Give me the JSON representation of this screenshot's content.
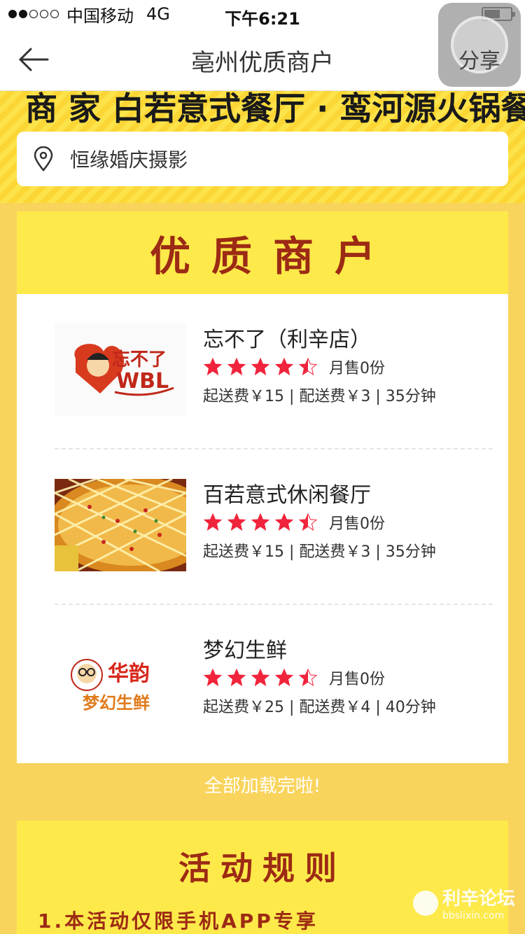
{
  "status_bar": {
    "signal_dots": 5,
    "signal_filled": 2,
    "carrier": "中国移动",
    "network": "4G",
    "time": "下午6:21",
    "battery_level": 0.5
  },
  "nav": {
    "back_icon": "arrow-left-icon",
    "title": "亳州优质商户",
    "share_label": "分享"
  },
  "banner": {
    "text_partial": "商  家  白若意式餐厅 · 鸾河源火锅餐厅"
  },
  "location": {
    "icon": "map-pin-icon",
    "text": "恒缘婚庆摄影"
  },
  "merchant_section": {
    "title": "优质商户",
    "merchants": [
      {
        "name": "忘不了（利辛店）",
        "rating": 4.5,
        "sales": "月售0份",
        "info": "起送费￥15 | 配送费￥3 | 35分钟",
        "logo_text_a": "忘不了",
        "logo_text_b": "WBL"
      },
      {
        "name": "百若意式休闲餐厅",
        "rating": 4.5,
        "sales": "月售0份",
        "info": "起送费￥15 | 配送费￥3 | 35分钟"
      },
      {
        "name": "梦幻生鲜",
        "rating": 4.5,
        "sales": "月售0份",
        "info": "起送费￥25 | 配送费￥4 | 40分钟",
        "logo_text_a": "华韵",
        "logo_text_b": "梦幻生鲜"
      }
    ]
  },
  "loaded_text": "全部加载完啦!",
  "rules": {
    "title": "活动规则",
    "line1": "1.本活动仅限手机APP专享"
  },
  "watermark": {
    "title": "利辛论坛",
    "sub": "bbslixin.com"
  },
  "colors": {
    "page_bg": "#f9d45c",
    "section_head_bg": "#fde94a",
    "title_red": "#9c2a14",
    "star_red": "#f0243c"
  }
}
